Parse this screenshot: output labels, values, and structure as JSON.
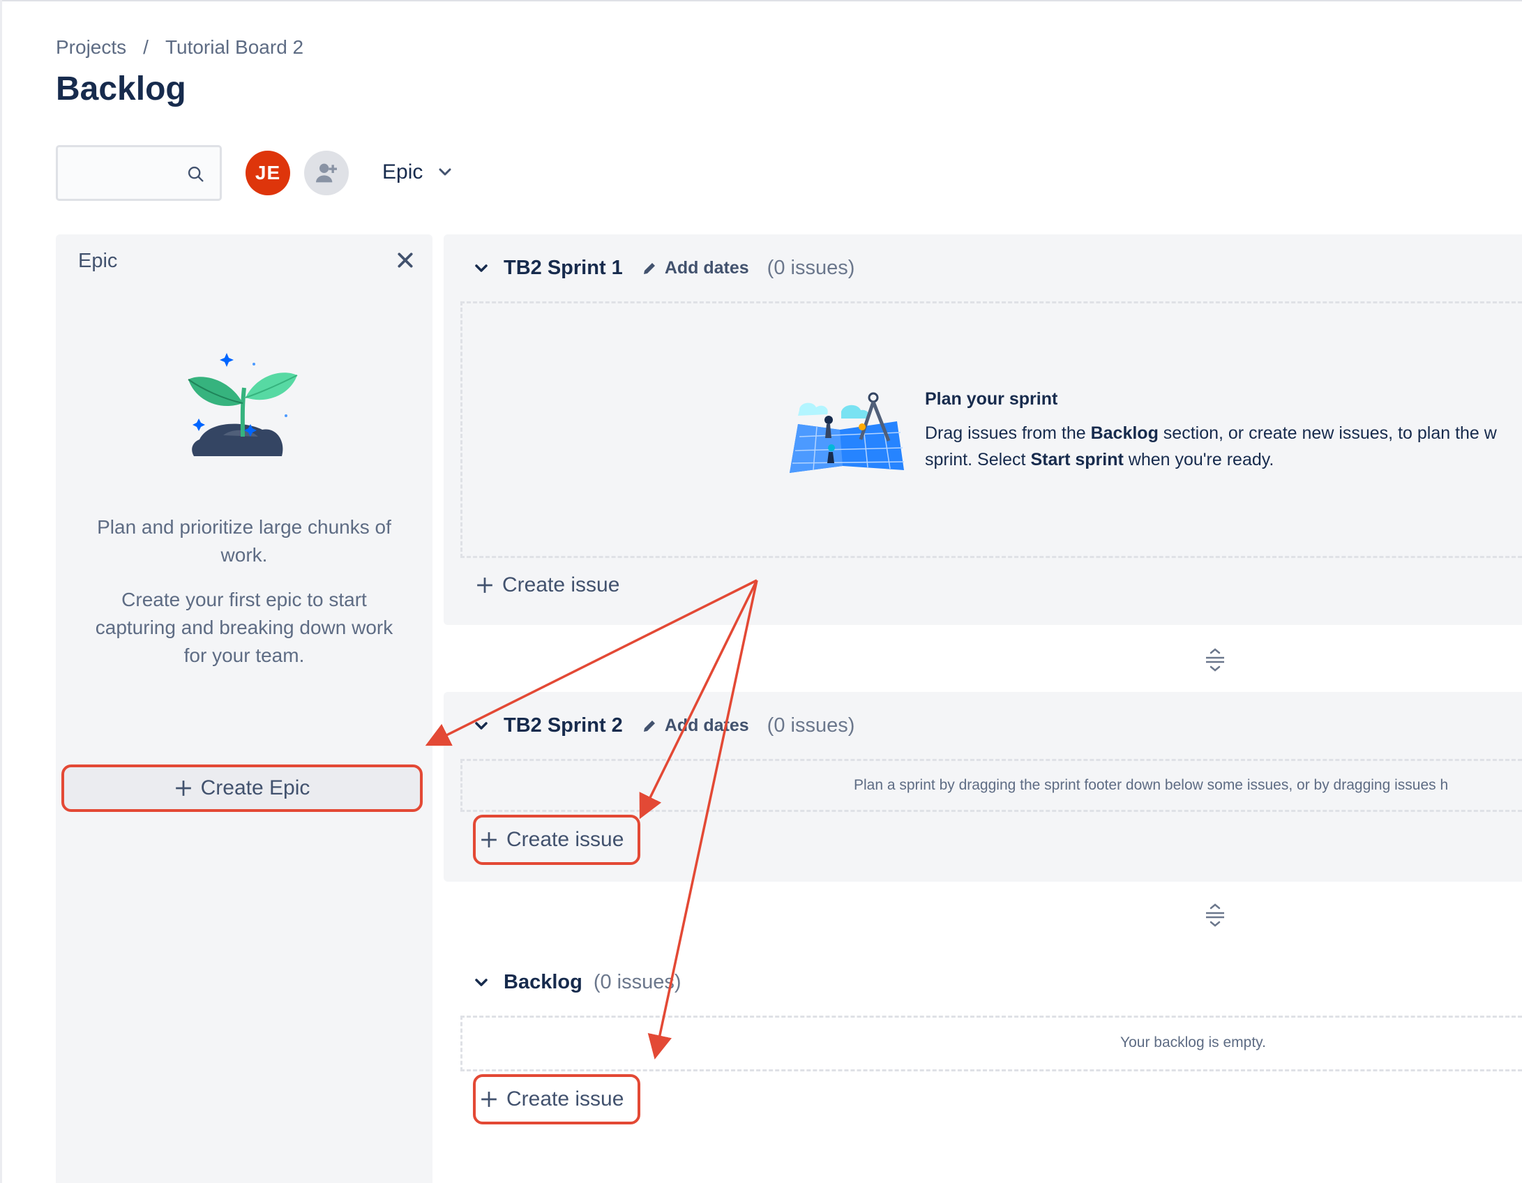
{
  "breadcrumb": {
    "projects": "Projects",
    "separator": "/",
    "board": "Tutorial Board 2"
  },
  "page_title": "Backlog",
  "toolbar": {
    "avatar_initials": "JE",
    "epic_filter_label": "Epic"
  },
  "epic_panel": {
    "title": "Epic",
    "text1": "Plan and prioritize large chunks of work.",
    "text2": "Create your first epic to start capturing and breaking down work for your team.",
    "create_label": "Create Epic"
  },
  "sprint1": {
    "name": "TB2 Sprint 1",
    "add_dates": "Add dates",
    "count": "(0 issues)",
    "plan_title": "Plan your sprint",
    "plan_l1_a": "Drag issues from the ",
    "plan_l1_b": "Backlog",
    "plan_l1_c": " section, or create new issues, to plan the w",
    "plan_l2_a": "sprint. Select ",
    "plan_l2_b": "Start sprint",
    "plan_l2_c": " when you're ready.",
    "create_label": "Create issue"
  },
  "sprint2": {
    "name": "TB2 Sprint 2",
    "add_dates": "Add dates",
    "count": "(0 issues)",
    "note": "Plan a sprint by dragging the sprint footer down below some issues, or by dragging issues h",
    "create_label": "Create issue"
  },
  "backlog": {
    "name": "Backlog",
    "count": "(0 issues)",
    "note": "Your backlog is empty.",
    "create_label": "Create issue"
  },
  "colors": {
    "accent_red": "#e34935",
    "avatar": "#de350b",
    "panel_bg": "#f4f5f7"
  },
  "icons": [
    "search-icon",
    "add-person-icon",
    "chevron-down-icon",
    "close-icon",
    "pencil-icon",
    "plus-icon",
    "drag-handle-icon"
  ]
}
